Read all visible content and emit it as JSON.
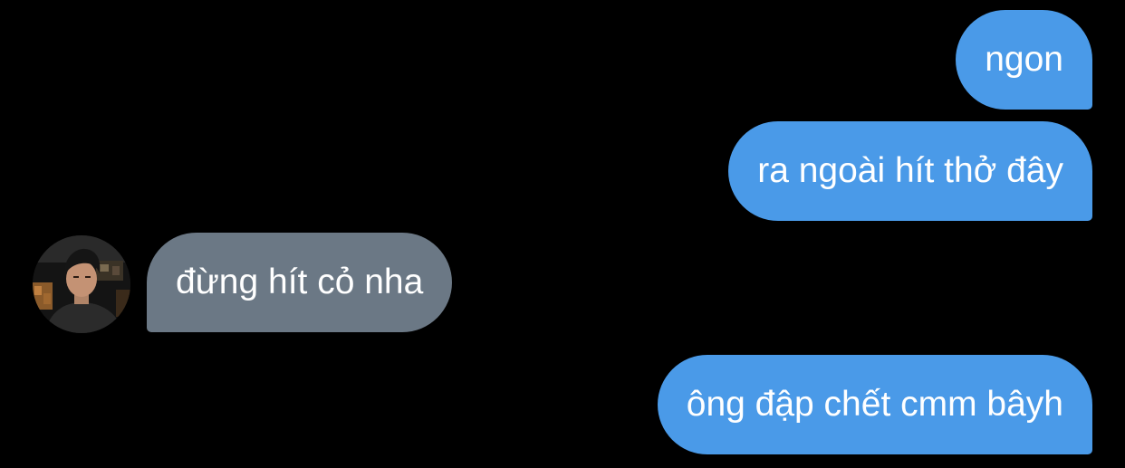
{
  "conversation": {
    "messages": [
      {
        "sender": "self",
        "text": "ngon"
      },
      {
        "sender": "self",
        "text": "ra ngoài hít thở đây"
      },
      {
        "sender": "other",
        "text": "đừng hít cỏ nha"
      },
      {
        "sender": "self",
        "text": "ông đập chết cmm bâyh"
      }
    ]
  },
  "colors": {
    "background": "#000000",
    "sent_bubble": "#4a9ae8",
    "received_bubble": "#6b7885",
    "text": "#ffffff"
  },
  "icons": {
    "avatar": "contact-photo"
  }
}
